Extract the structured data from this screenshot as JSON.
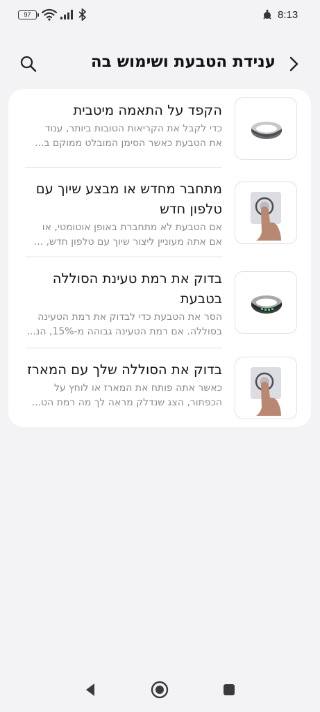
{
  "status_bar": {
    "battery_level": "97",
    "time": "8:13",
    "icons": [
      "battery-icon",
      "wifi-icon",
      "signal-icon",
      "bluetooth-icon",
      "alarm-icon"
    ]
  },
  "header": {
    "title": "ענידת הטבעת ושימוש בה",
    "back_icon": "chevron-right-icon",
    "search_icon": "search-icon"
  },
  "items": [
    {
      "title": "הקפד על התאמה מיטבית",
      "desc_line1": "כדי לקבל את הקריאות הטובות ביותר, ענוד",
      "desc_line2": "את הטבעת כאשר הסימן המובלט ממוקם ב...",
      "thumb": "ring-icon"
    },
    {
      "title_line1": "מתחבר מחדש או מבצע שיוך עם",
      "title_line2": "טלפון חדש",
      "desc_line1": "אם הטבעת לא מתחברת באופן אוטומטי, או",
      "desc_line2": "אם אתה מעוניין ליצור שיוך עם טלפון חדש, ...",
      "thumb": "finger-press-icon"
    },
    {
      "title_line1": "בדוק את רמת טעינת הסוללה",
      "title_line2": "בטבעת",
      "desc_line1": "הסר את הטבעת כדי לבדוק את רמת הטעינה",
      "desc_line2": "בסוללה. אם רמת הטעינה גבוהה מ-15%, הנ...",
      "thumb": "ring-battery-icon"
    },
    {
      "title": "בדוק את הסוללה שלך עם המארז",
      "desc_line1": "כאשר אתה פותח את המארז או לוחץ על",
      "desc_line2": "הכפתור, הצג שנדלק מראה לך מה רמת הט...",
      "thumb": "finger-press-icon"
    }
  ],
  "nav_bar": {
    "icons": [
      "back-triangle-icon",
      "home-circle-icon",
      "recents-square-icon"
    ]
  }
}
